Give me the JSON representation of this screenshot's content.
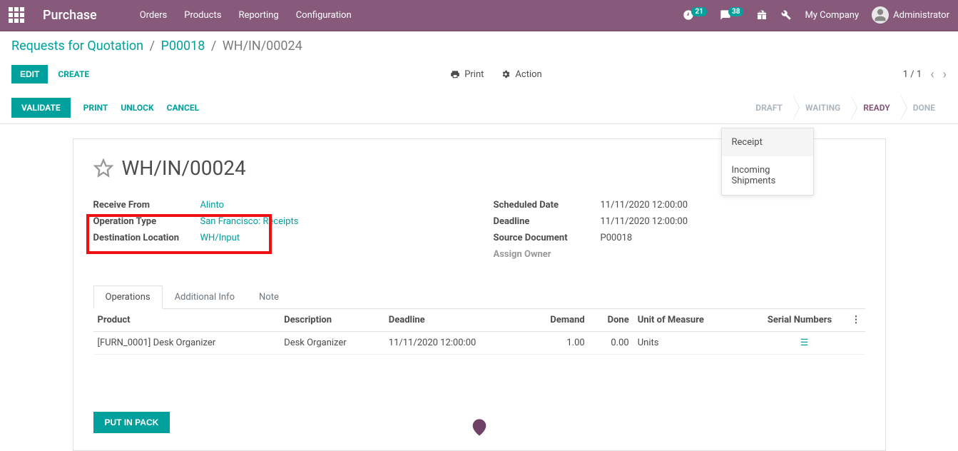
{
  "brand": "Purchase",
  "topmenu": [
    "Orders",
    "Products",
    "Reporting",
    "Configuration"
  ],
  "badges": {
    "activity": "21",
    "discuss": "38"
  },
  "company": "My Company",
  "user": "Administrator",
  "breadcrumb": {
    "root": "Requests for Quotation",
    "parent": "P00018",
    "current": "WH/IN/00024"
  },
  "actions": {
    "edit": "EDIT",
    "create": "CREATE",
    "print": "Print",
    "action": "Action"
  },
  "pager": {
    "current": "1",
    "total": "1"
  },
  "status_buttons": {
    "validate": "VALIDATE",
    "print": "PRINT",
    "unlock": "UNLOCK",
    "cancel": "CANCEL"
  },
  "status_flow": [
    "DRAFT",
    "WAITING",
    "READY",
    "DONE"
  ],
  "dropdown": [
    "Receipt",
    "Incoming Shipments"
  ],
  "title": "WH/IN/00024",
  "fields": {
    "receive_from": {
      "label": "Receive From",
      "value": "Alinto"
    },
    "operation_type": {
      "label": "Operation Type",
      "value": "San Francisco: Receipts"
    },
    "destination_location": {
      "label": "Destination Location",
      "value": "WH/Input"
    },
    "scheduled_date": {
      "label": "Scheduled Date",
      "value": "11/11/2020 12:00:00"
    },
    "deadline": {
      "label": "Deadline",
      "value": "11/11/2020 12:00:00"
    },
    "source_document": {
      "label": "Source Document",
      "value": "P00018"
    },
    "assign_owner": {
      "label": "Assign Owner",
      "value": ""
    }
  },
  "tabs": [
    "Operations",
    "Additional Info",
    "Note"
  ],
  "table": {
    "headers": {
      "product": "Product",
      "description": "Description",
      "deadline": "Deadline",
      "demand": "Demand",
      "done": "Done",
      "uom": "Unit of Measure",
      "serial": "Serial Numbers"
    },
    "rows": [
      {
        "product": "[FURN_0001] Desk Organizer",
        "description": "Desk Organizer",
        "deadline": "11/11/2020 12:00:00",
        "demand": "1.00",
        "done": "0.00",
        "uom": "Units"
      }
    ]
  },
  "put_in_pack": "PUT IN PACK"
}
